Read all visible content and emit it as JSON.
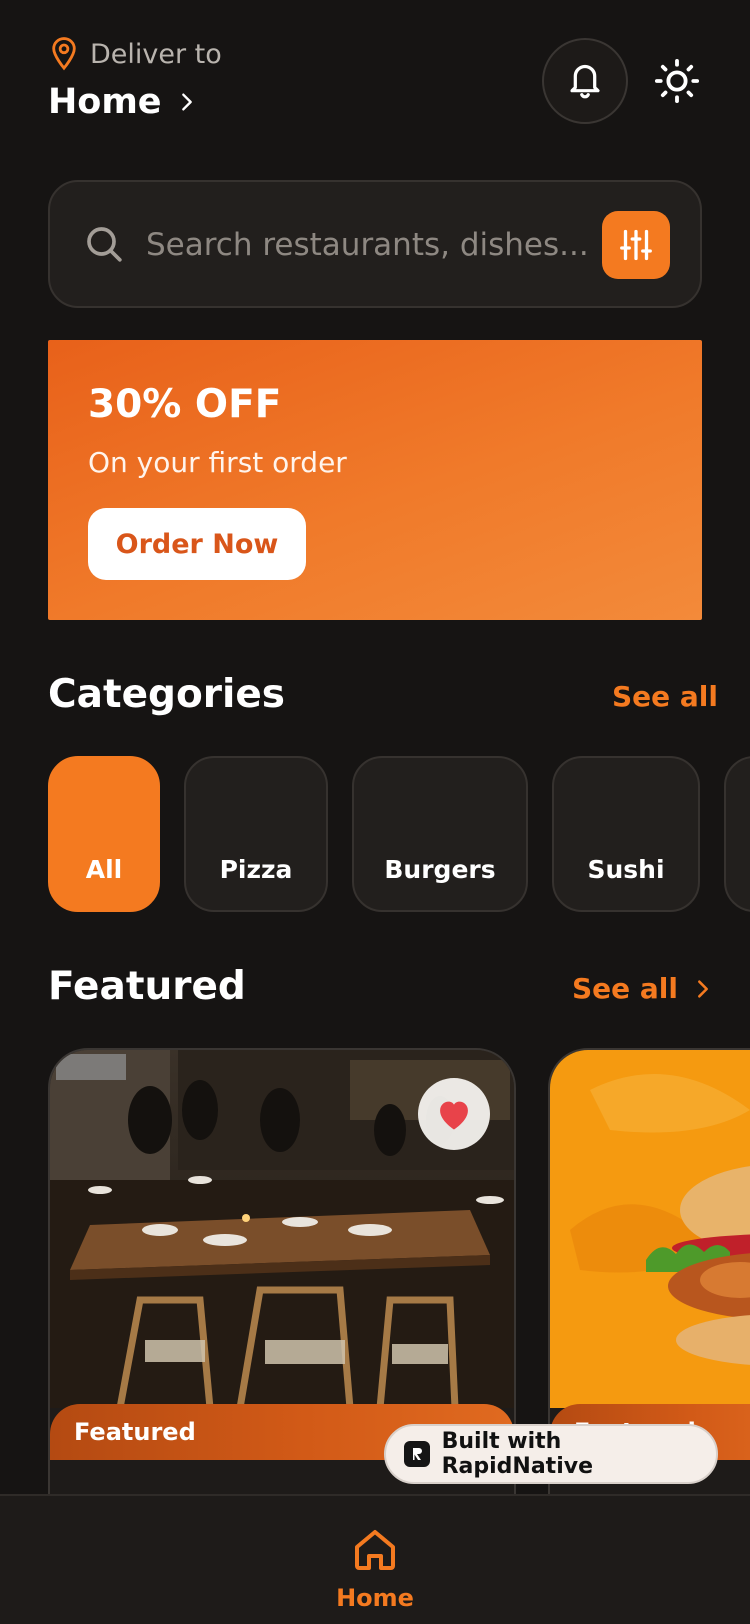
{
  "header": {
    "deliver_label": "Deliver to",
    "location": "Home",
    "icons": [
      "map-pin-icon",
      "chevron-right-icon",
      "bell-icon",
      "sun-icon"
    ]
  },
  "search": {
    "placeholder": "Search restaurants, dishes...",
    "value": "",
    "icons": [
      "search-icon",
      "sliders-icon"
    ]
  },
  "promo": {
    "title": "30% OFF",
    "subtitle": "On your first order",
    "button_label": "Order Now"
  },
  "categories": {
    "title": "Categories",
    "see_all": "See all",
    "items": [
      {
        "label": "All",
        "active": true
      },
      {
        "label": "Pizza",
        "active": false
      },
      {
        "label": "Burgers",
        "active": false
      },
      {
        "label": "Sushi",
        "active": false
      }
    ]
  },
  "featured": {
    "title": "Featured",
    "see_all": "See all",
    "cards": [
      {
        "badge": "Featured",
        "image": "restaurant-dining-room",
        "favorited": true
      },
      {
        "badge": "Featured",
        "image": "chicken-burger-orange-background",
        "favorited": false
      }
    ]
  },
  "built_with": {
    "label": "Built with RapidNative"
  },
  "bottom_nav": {
    "items": [
      {
        "label": "Home",
        "icon": "home-icon",
        "active": true
      }
    ]
  },
  "colors": {
    "background": "#161413",
    "surface": "#221f1d",
    "accent": "#f47a20",
    "heart": "#e8434a"
  }
}
